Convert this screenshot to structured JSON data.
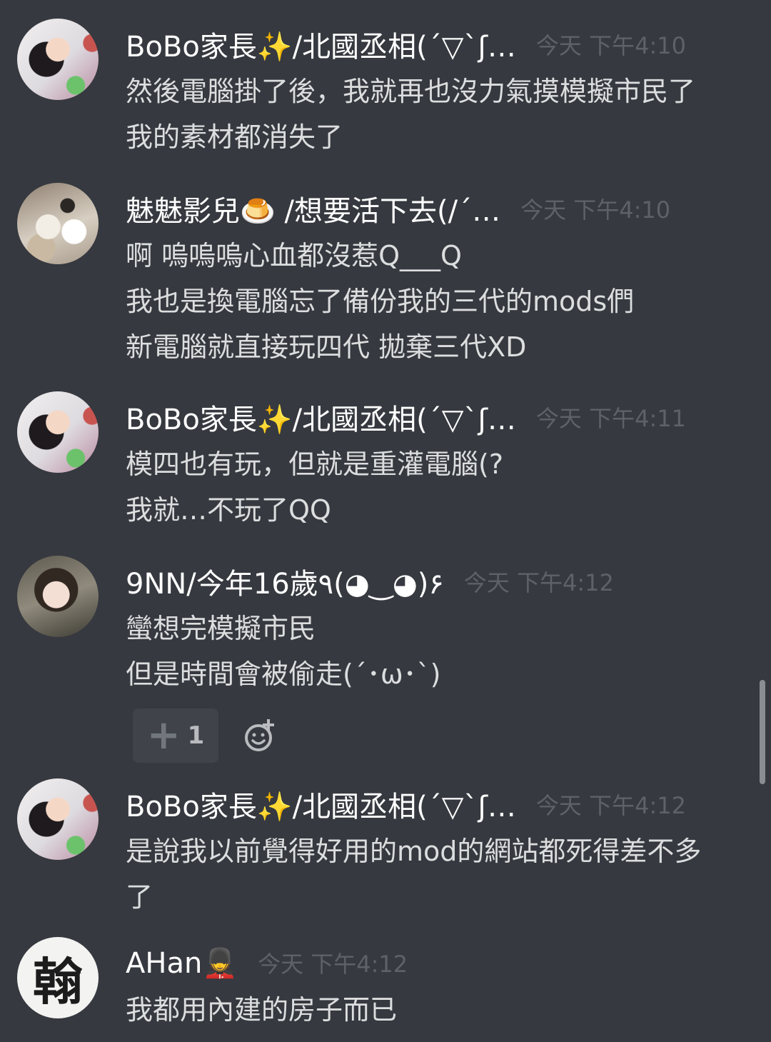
{
  "messages": [
    {
      "username": "BoBo家長✨/北國丞相(´▽`ʃ…",
      "timestamp": "今天 下午4:10",
      "lines": [
        "然後電腦掛了後，我就再也沒力氣摸模擬市民了",
        "我的素材都消失了"
      ]
    },
    {
      "username": "魅魅影兒🍮 /想要活下去(/´…",
      "timestamp": "今天 下午4:10",
      "lines": [
        "啊 嗚嗚嗚心血都沒惹Q___Q",
        "我也是換電腦忘了備份我的三代的mods們",
        "新電腦就直接玩四代 拋棄三代XD"
      ]
    },
    {
      "username": "BoBo家長✨/北國丞相(´▽`ʃ…",
      "timestamp": "今天 下午4:11",
      "lines": [
        "模四也有玩，但就是重灌電腦(?",
        "我就…不玩了QQ"
      ]
    },
    {
      "username": "9NN/今年16歲٩(◕‿◕)۶",
      "timestamp": "今天 下午4:12",
      "lines": [
        "蠻想完模擬市民",
        "但是時間會被偷走(´･ω･`)"
      ],
      "reaction": {
        "emoji": "plus-icon",
        "count": "1"
      }
    },
    {
      "username": "BoBo家長✨/北國丞相(´▽`ʃ…",
      "timestamp": "今天 下午4:12",
      "lines": [
        "是說我以前覺得好用的mod的網站都死得差不多",
        "了"
      ]
    },
    {
      "username": "AHan💂",
      "timestamp": "今天 下午4:12",
      "lines": [
        "我都用內建的房子而已"
      ],
      "avatar_text": "翰"
    }
  ]
}
